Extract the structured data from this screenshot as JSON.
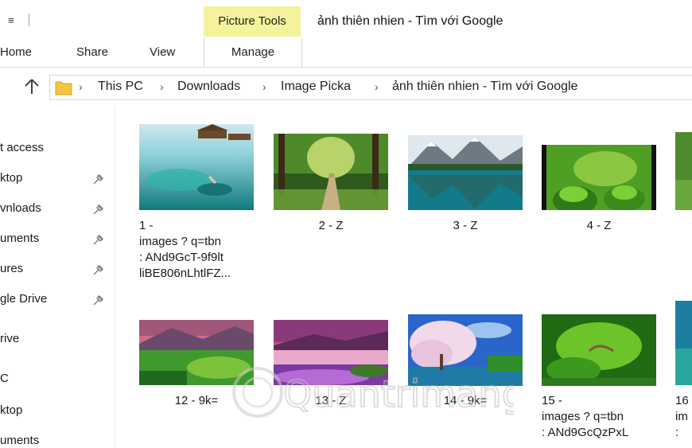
{
  "quick_access_arrow": "≡",
  "ribbon": {
    "contextual_group": "Picture Tools",
    "window_title": "ảnh thiên nhien - Tìm với Google",
    "tabs": [
      "Home",
      "Share",
      "View",
      "Manage"
    ]
  },
  "address_bar": {
    "crumbs": [
      "This PC",
      "Downloads",
      "Image Picka",
      "ảnh thiên nhien - Tìm với Google"
    ]
  },
  "nav_pane": {
    "items": [
      {
        "label": "t access",
        "pinned": false
      },
      {
        "label": "ktop",
        "pinned": true
      },
      {
        "label": "vnloads",
        "pinned": true
      },
      {
        "label": "uments",
        "pinned": true
      },
      {
        "label": "ures",
        "pinned": true
      },
      {
        "label": "gle Drive",
        "pinned": true
      },
      {
        "label": "rive",
        "pinned": false
      },
      {
        "label": "C",
        "pinned": false
      },
      {
        "label": "ktop",
        "pinned": false
      },
      {
        "label": "uments",
        "pinned": false
      }
    ]
  },
  "files": [
    {
      "lines": [
        "1 -",
        "images ? q=tbn",
        "  : ANd9GcT-9f9lt",
        "liBE806nLhtlFZ..."
      ]
    },
    {
      "lines": [
        "2 - Z"
      ]
    },
    {
      "lines": [
        "3 - Z"
      ]
    },
    {
      "lines": [
        "4 - Z"
      ]
    },
    {
      "lines": []
    },
    {
      "lines": [
        "12 - 9k="
      ]
    },
    {
      "lines": [
        "13 - Z"
      ]
    },
    {
      "lines": [
        "14 - 9k="
      ]
    },
    {
      "lines": [
        "15 -",
        "images ? q=tbn",
        "  : ANd9GcQzPxL"
      ]
    },
    {
      "lines": [
        "16",
        "im",
        "  :"
      ]
    }
  ],
  "watermark": "Quantrimang",
  "colors": {
    "picture_tools_bg": "#f4f39b",
    "folder": "#f4c542"
  }
}
